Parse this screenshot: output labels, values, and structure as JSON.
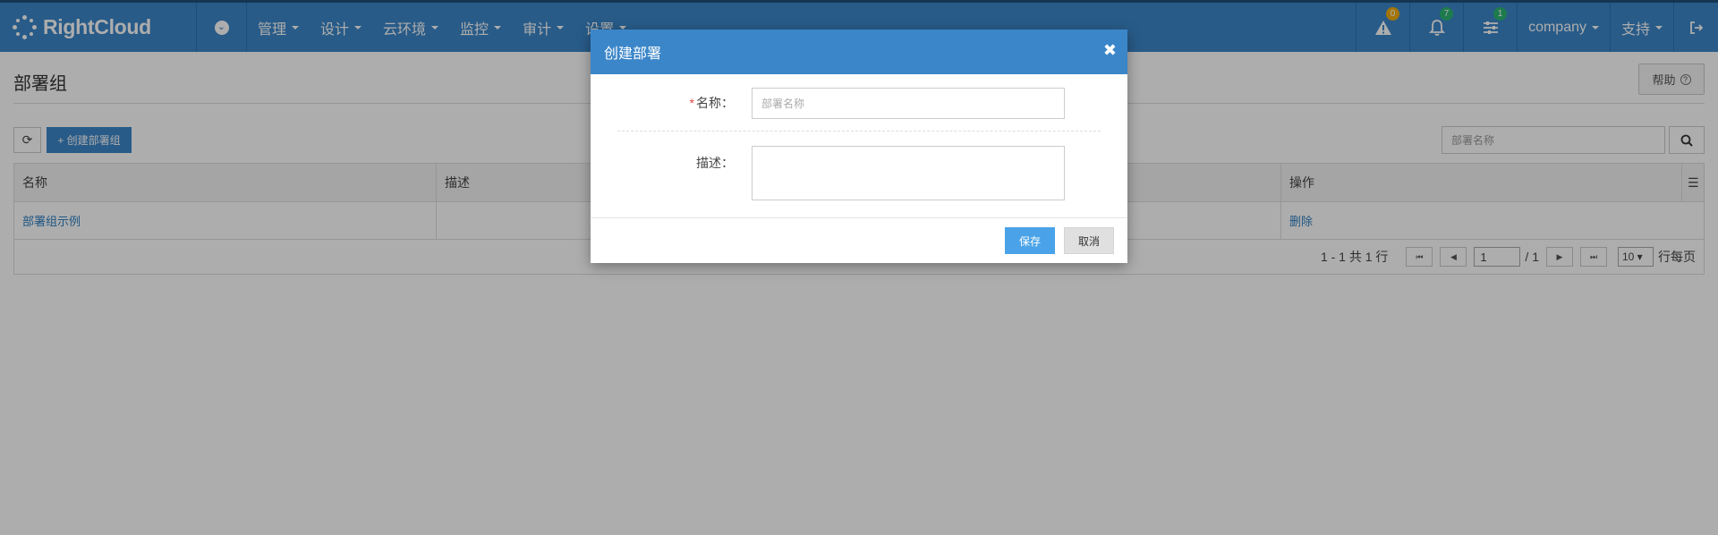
{
  "app": {
    "name": "RightCloud"
  },
  "nav": {
    "items": [
      {
        "label": "管理"
      },
      {
        "label": "设计"
      },
      {
        "label": "云环境"
      },
      {
        "label": "监控"
      },
      {
        "label": "审计"
      },
      {
        "label": "设置"
      }
    ],
    "alerts_count": "0",
    "notifications_count": "7",
    "tasks_count": "1",
    "company_label": "company",
    "support_label": "支持"
  },
  "page": {
    "title": "部署组",
    "help_label": "帮助",
    "create_button_label": "+ 创建部署组",
    "search_placeholder": "部署名称"
  },
  "table": {
    "columns": [
      "名称",
      "描述",
      "",
      "操作"
    ],
    "rows": [
      {
        "name": "部署组示例",
        "description": "",
        "action": "删除"
      }
    ]
  },
  "pagination": {
    "summary": "1 - 1 共 1 行",
    "current_page": "1",
    "total_pages": "/ 1",
    "page_size": "10 ▾",
    "page_size_suffix": "行每页"
  },
  "modal": {
    "title": "创建部署",
    "name_label": "名称：",
    "name_placeholder": "部署名称",
    "description_label": "描述：",
    "save_label": "保存",
    "cancel_label": "取消"
  },
  "colors": {
    "primary": "#3b86c9",
    "link": "#2e7fc2",
    "badge_yellow": "#f0ad0e",
    "badge_green": "#2bb673",
    "required": "#e04848"
  }
}
